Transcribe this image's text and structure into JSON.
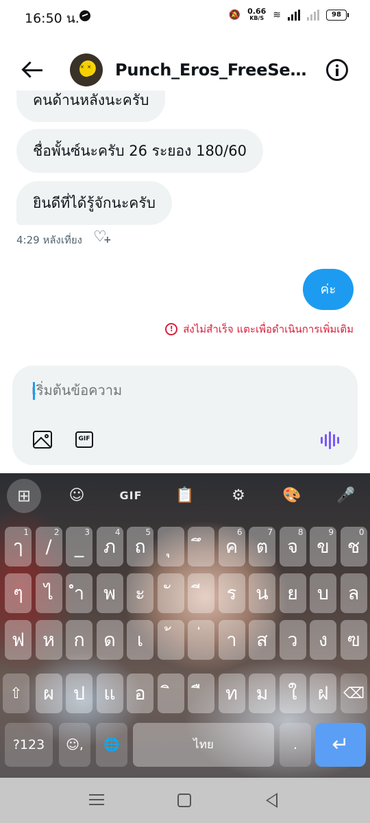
{
  "status_bar": {
    "time": "16:50 น.",
    "net_speed": "0.66",
    "net_unit": "KB/S",
    "battery": "98"
  },
  "header": {
    "title": "Punch_Eros_FreeSexTo..."
  },
  "messages": {
    "incoming": [
      "คนด้านหลังนะครับ",
      "ชื่อพั้นซ์นะครับ 26 ระยอง 180/60",
      "ยินดีที่ได้รู้จักนะครับ"
    ],
    "time": "4:29 หลังเที่ยง",
    "outgoing": "ค่ะ",
    "send_error": "ส่งไม่สำเร็จ แตะเพื่อดำเนินการเพิ่มเติม"
  },
  "composer": {
    "placeholder": "เริ่มต้นข้อความ",
    "gif_label": "GIF"
  },
  "keyboard": {
    "toolbar": {
      "apps": "⊞",
      "sticker": "☺",
      "gif": "GIF",
      "clipboard": "📋",
      "settings": "⚙",
      "theme": "🎨",
      "mic": "🎤"
    },
    "rows": [
      [
        [
          "ๅ",
          "1"
        ],
        [
          "/",
          "2"
        ],
        [
          "_",
          "3"
        ],
        [
          "ภ",
          "4"
        ],
        [
          "ถ",
          "5"
        ],
        [
          "ุ",
          ""
        ],
        [
          "ึ",
          ""
        ],
        [
          "ค",
          "6"
        ],
        [
          "ต",
          "7"
        ],
        [
          "จ",
          "8"
        ],
        [
          "ข",
          "9"
        ],
        [
          "ช",
          "0"
        ]
      ],
      [
        [
          "ๆ",
          ""
        ],
        [
          "ไ",
          ""
        ],
        [
          "ำ",
          ""
        ],
        [
          "พ",
          ""
        ],
        [
          "ะ",
          ""
        ],
        [
          "ั",
          ""
        ],
        [
          "ี",
          ""
        ],
        [
          "ร",
          ""
        ],
        [
          "น",
          ""
        ],
        [
          "ย",
          ""
        ],
        [
          "บ",
          ""
        ],
        [
          "ล",
          ""
        ]
      ],
      [
        [
          "ฟ",
          ""
        ],
        [
          "ห",
          ""
        ],
        [
          "ก",
          ""
        ],
        [
          "ด",
          ""
        ],
        [
          "เ",
          ""
        ],
        [
          "้",
          ""
        ],
        [
          "่",
          ""
        ],
        [
          "า",
          ""
        ],
        [
          "ส",
          ""
        ],
        [
          "ว",
          ""
        ],
        [
          "ง",
          ""
        ],
        [
          "ฃ",
          ""
        ]
      ],
      [
        [
          "ผ",
          ""
        ],
        [
          "ป",
          ""
        ],
        [
          "แ",
          ""
        ],
        [
          "อ",
          ""
        ],
        [
          "ิ",
          ""
        ],
        [
          "ื",
          ""
        ],
        [
          "ท",
          ""
        ],
        [
          "ม",
          ""
        ],
        [
          "ใ",
          ""
        ],
        [
          "ฝ",
          ""
        ]
      ]
    ],
    "shift": "⇧",
    "backspace": "⌫",
    "sym_label": "?123",
    "emoji_comma": "☺,",
    "globe": "🌐",
    "space_label": "ไทย",
    "period": ".",
    "enter": "↵"
  },
  "nav_bar": {
    "recent": "recent-apps",
    "home": "home",
    "back": "back"
  }
}
